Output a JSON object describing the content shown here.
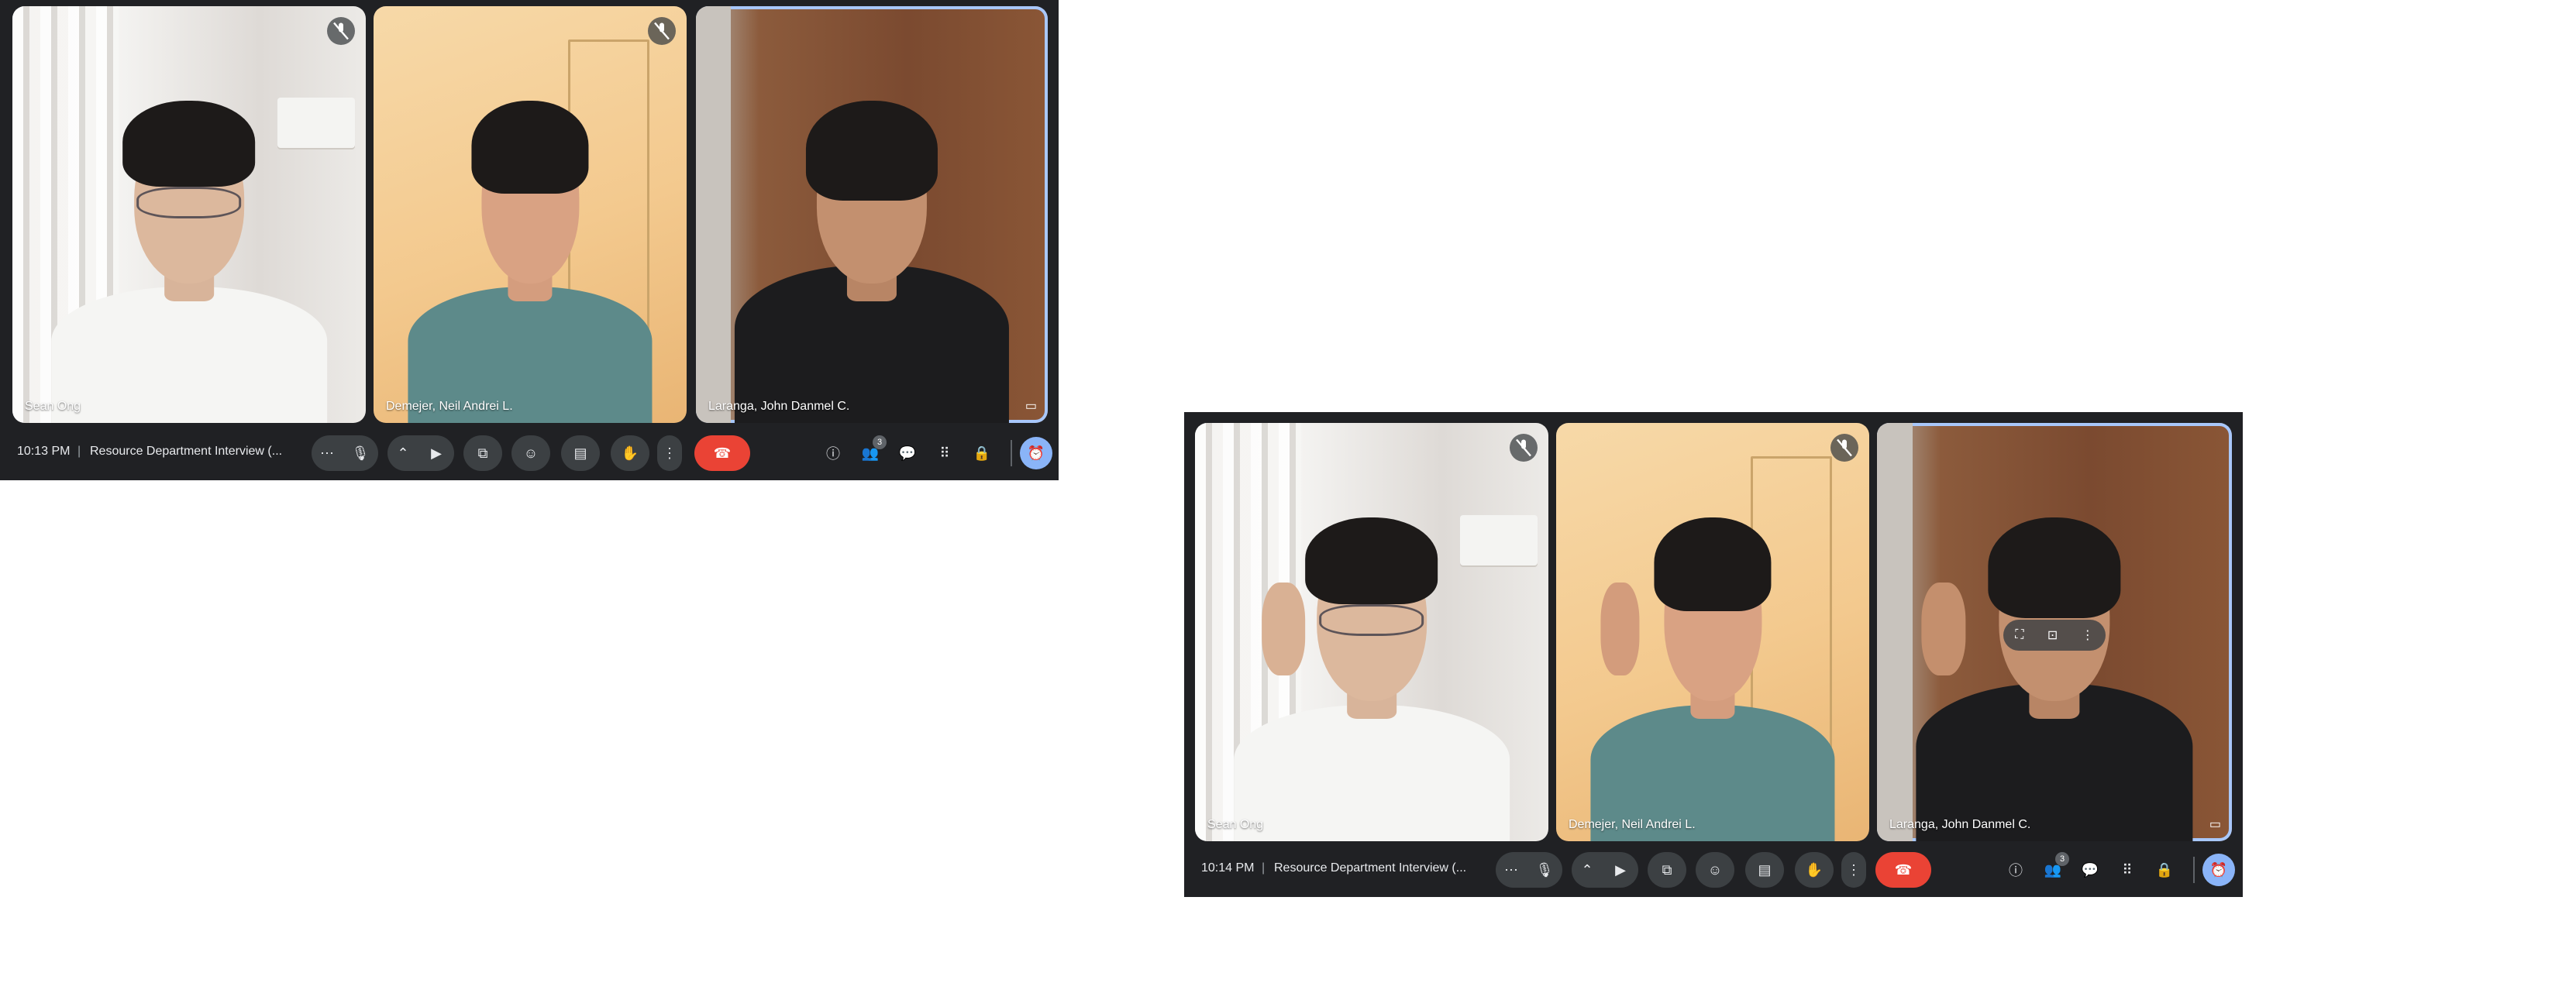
{
  "screenshots": [
    {
      "participants": [
        {
          "name": "Sean Ong",
          "muted": true
        },
        {
          "name": "Demejer, Neil Andrei L.",
          "muted": true
        },
        {
          "name": "Laranga, John Danmel C.",
          "muted": false,
          "speaking": true
        }
      ],
      "bottom_bar": {
        "time": "10:13 PM",
        "separator": "|",
        "meeting_title": "Resource Department Interview (...",
        "people_count": "3"
      }
    },
    {
      "participants": [
        {
          "name": "Sean Ong",
          "muted": true
        },
        {
          "name": "Demejer, Neil Andrei L.",
          "muted": true
        },
        {
          "name": "Laranga, John Danmel C.",
          "muted": false,
          "speaking": true
        }
      ],
      "bottom_bar": {
        "time": "10:14 PM",
        "separator": "|",
        "meeting_title": "Resource Department Interview (...",
        "people_count": "3"
      }
    }
  ],
  "icons": {
    "mic_muted": "mic-off-icon",
    "more_options": "more-horiz-icon",
    "mic": "mic-icon",
    "chevron": "chevron-up-icon",
    "camera": "videocam-icon",
    "present": "present-screen-icon",
    "emoji": "emoji-icon",
    "captions": "captions-icon",
    "raise_hand": "raise-hand-icon",
    "more_vert": "more-vert-icon",
    "end_call": "end-call-icon",
    "info": "info-icon",
    "people": "people-icon",
    "chat": "chat-icon",
    "activities": "apps-grid-icon",
    "host_controls": "lock-person-icon",
    "timer": "timer-icon",
    "pin": "pip-icon"
  },
  "colors": {
    "meeting_background": "#202124",
    "control_button": "#3c4043",
    "end_call_button": "#ea4335",
    "speaking_outline": "#a8c7fa",
    "timer_accent": "#8ab4f8"
  }
}
